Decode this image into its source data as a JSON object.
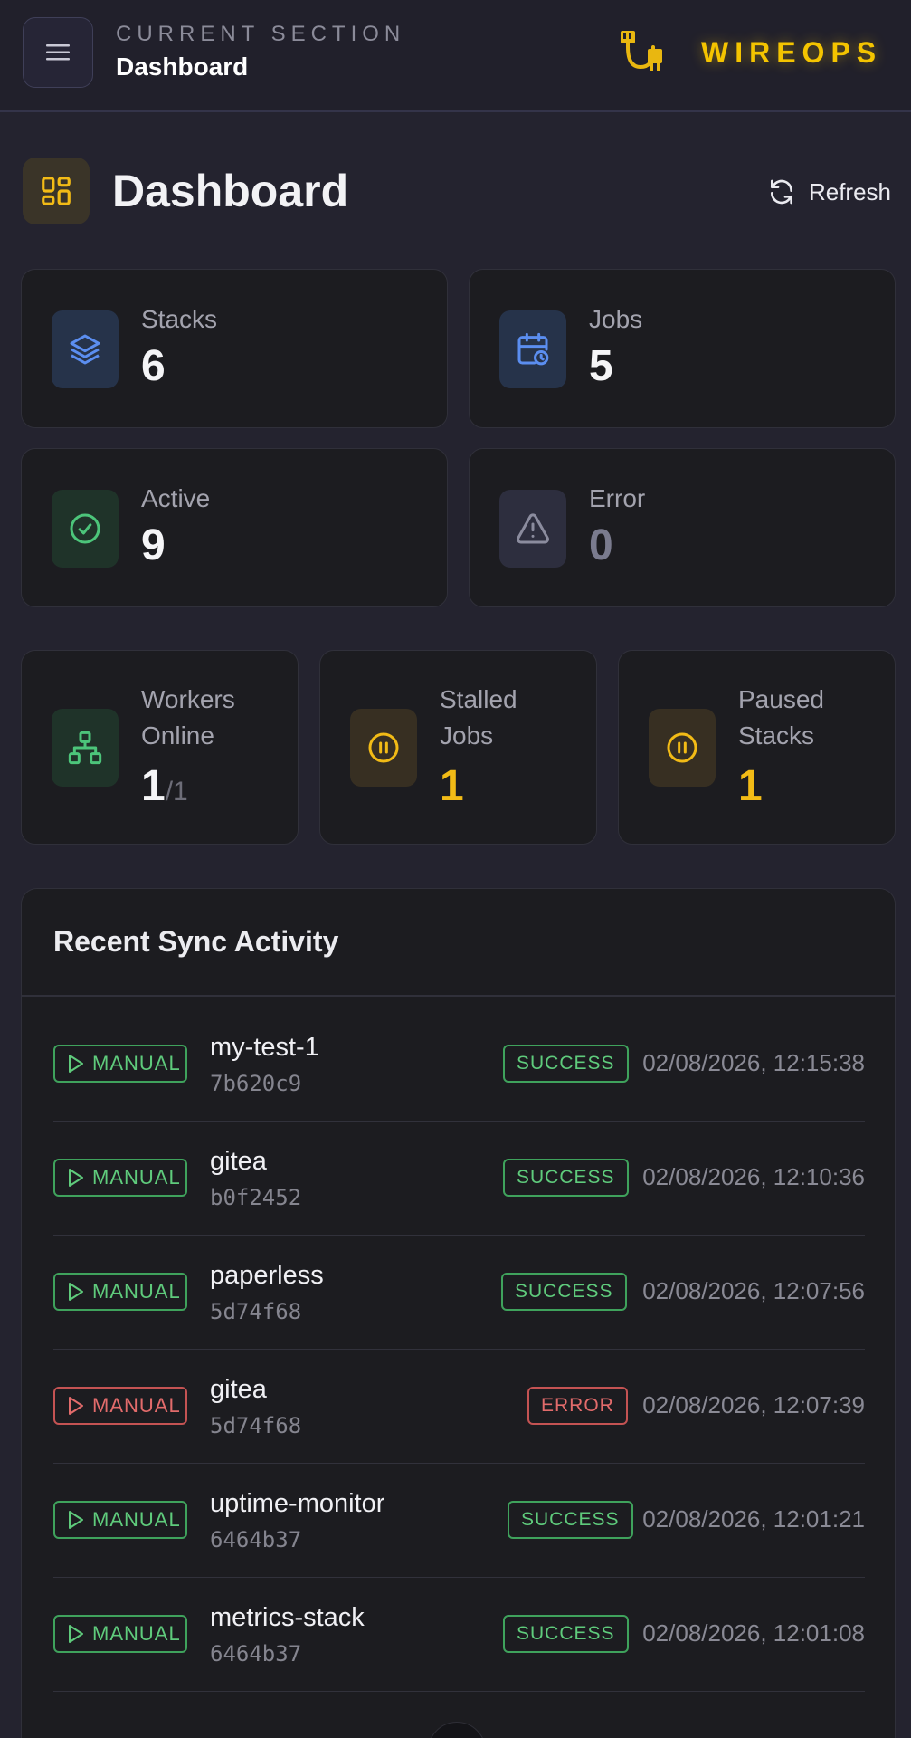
{
  "header": {
    "kicker": "CURRENT SECTION",
    "section": "Dashboard",
    "brand": "WIREOPS"
  },
  "page": {
    "title": "Dashboard",
    "refresh_label": "Refresh"
  },
  "stats": {
    "stacks": {
      "label": "Stacks",
      "value": "6",
      "icon": "layers-icon"
    },
    "jobs": {
      "label": "Jobs",
      "value": "5",
      "icon": "calendar-clock-icon"
    },
    "active": {
      "label": "Active",
      "value": "9",
      "icon": "check-circle-icon"
    },
    "error": {
      "label": "Error",
      "value": "0",
      "icon": "warning-icon"
    },
    "workers": {
      "label_1": "Workers",
      "label_2": "Online",
      "value": "1",
      "total": "/1",
      "icon": "network-icon"
    },
    "stalled": {
      "label_1": "Stalled",
      "label_2": "Jobs",
      "value": "1",
      "icon": "pause-circle-icon"
    },
    "paused": {
      "label_1": "Paused",
      "label_2": "Stacks",
      "value": "1",
      "icon": "pause-circle-icon"
    }
  },
  "activity": {
    "title": "Recent Sync Activity",
    "rows": [
      {
        "trigger": "MANUAL",
        "name": "my-test-1",
        "hash": "7b620c9",
        "status": "SUCCESS",
        "time": "02/08/2026, 12:15:38"
      },
      {
        "trigger": "MANUAL",
        "name": "gitea",
        "hash": "b0f2452",
        "status": "SUCCESS",
        "time": "02/08/2026, 12:10:36"
      },
      {
        "trigger": "MANUAL",
        "name": "paperless",
        "hash": "5d74f68",
        "status": "SUCCESS",
        "time": "02/08/2026, 12:07:56"
      },
      {
        "trigger": "MANUAL",
        "name": "gitea",
        "hash": "5d74f68",
        "status": "ERROR",
        "time": "02/08/2026, 12:07:39"
      },
      {
        "trigger": "MANUAL",
        "name": "uptime-monitor",
        "hash": "6464b37",
        "status": "SUCCESS",
        "time": "02/08/2026, 12:01:21"
      },
      {
        "trigger": "MANUAL",
        "name": "metrics-stack",
        "hash": "6464b37",
        "status": "SUCCESS",
        "time": "02/08/2026, 12:01:08"
      }
    ]
  },
  "colors": {
    "accent": "#f4c400",
    "success": "#5fcb7c",
    "error": "#e26b6b",
    "amber": "#f2bb16",
    "blue": "#5b8ef0",
    "background": "#24232f",
    "card": "#1c1c20"
  }
}
